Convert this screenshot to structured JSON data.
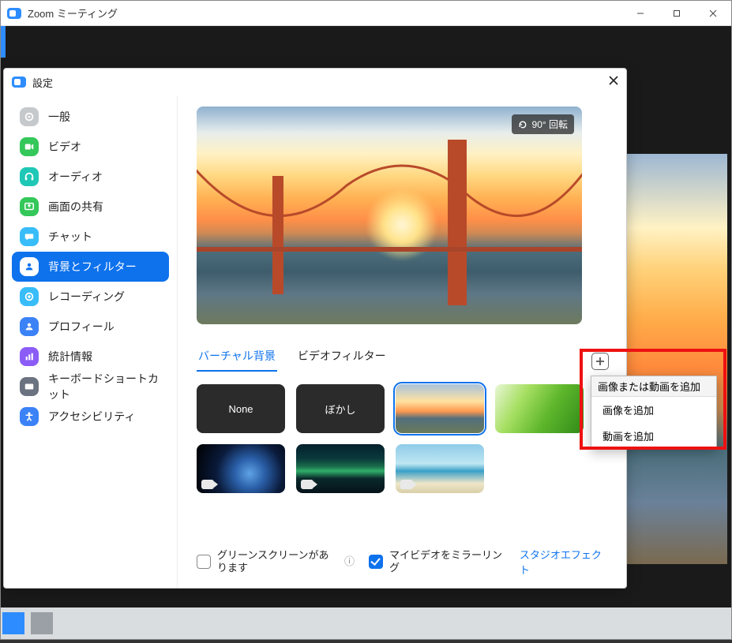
{
  "parent_window": {
    "title": "Zoom ミーティング"
  },
  "dialog": {
    "title": "設定",
    "sidebar": {
      "items": [
        {
          "label": "一般",
          "color": "#c5c9cc"
        },
        {
          "label": "ビデオ",
          "color": "#34c759"
        },
        {
          "label": "オーディオ",
          "color": "#1fc7b6"
        },
        {
          "label": "画面の共有",
          "color": "#34c759"
        },
        {
          "label": "チャット",
          "color": "#38bdf8"
        },
        {
          "label": "背景とフィルター",
          "color": "#0e72ed"
        },
        {
          "label": "レコーディング",
          "color": "#38bdf8"
        },
        {
          "label": "プロフィール",
          "color": "#3b82f6"
        },
        {
          "label": "統計情報",
          "color": "#8b5cf6"
        },
        {
          "label": "キーボードショートカット",
          "color": "#6b7280"
        },
        {
          "label": "アクセシビリティ",
          "color": "#3b82f6"
        }
      ],
      "active_index": 5
    },
    "preview": {
      "rotate_label": "90° 回転"
    },
    "tabs": {
      "items": [
        "バーチャル背景",
        "ビデオフィルター"
      ],
      "active_index": 0
    },
    "thumbs": {
      "none_label": "None",
      "blur_label": "ぼかし",
      "selected_index": 2
    },
    "footer": {
      "greenscreen_label": "グリーンスクリーンがあります",
      "mirror_label": "マイビデオをミラーリング",
      "studio_label": "スタジオエフェクト"
    },
    "popup": {
      "header": "画像または動画を追加",
      "add_image": "画像を追加",
      "add_video": "動画を追加"
    }
  }
}
